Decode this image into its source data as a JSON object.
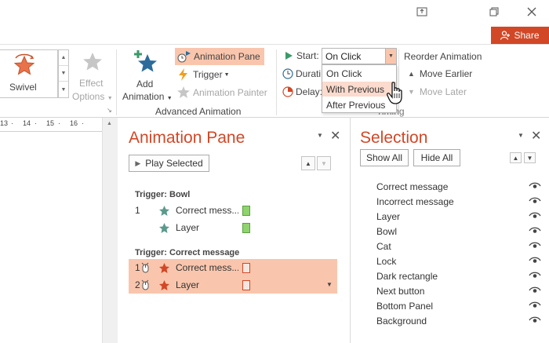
{
  "window": {
    "restore_icon": "restore-window-icon",
    "maximize_icon": "maximize-icon",
    "close_icon": "close-icon"
  },
  "share": {
    "label": "Share",
    "icon": "person-icon",
    "color": "#d24726"
  },
  "ribbon": {
    "swivel_label": "Swivel",
    "effect_options_label_1": "Effect",
    "effect_options_label_2": "Options",
    "add_animation_label_1": "Add",
    "add_animation_label_2": "Animation",
    "animation_pane_label": "Animation Pane",
    "trigger_label": "Trigger",
    "animation_painter_label": "Animation Painter",
    "group_advanced": "Advanced Animation",
    "start_label": "Start:",
    "start_value": "On Click",
    "duration_label": "Durati",
    "delay_label": "Delay:",
    "timing_group": "Timing",
    "reorder_label": "Reorder Animation",
    "move_earlier_label": "Move Earlier",
    "move_later_label": "Move Later",
    "start_options": [
      "On Click",
      "With Previous",
      "After Previous"
    ]
  },
  "ruler": {
    "ticks": [
      "13",
      "14",
      "15",
      "16"
    ]
  },
  "animation_pane": {
    "title": "Animation Pane",
    "play_selected": "Play Selected",
    "groups": [
      {
        "trigger": "Trigger: Bowl",
        "items": [
          {
            "num": "1",
            "name": "Correct mess...",
            "star_color": "#5a9a8c",
            "box_color": "#8ed36c",
            "box_border": "#5aa040"
          },
          {
            "num": "",
            "name": "Layer",
            "star_color": "#5a9a8c",
            "box_color": "#8ed36c",
            "box_border": "#5aa040"
          }
        ]
      },
      {
        "trigger": "Trigger: Correct message",
        "items": [
          {
            "num": "1",
            "name": "Correct mess...",
            "star_color": "#d24726",
            "box_color": "#f6e6e0",
            "box_border": "#d24726"
          },
          {
            "num": "2",
            "name": "Layer",
            "star_color": "#d24726",
            "box_color": "#f6e6e0",
            "box_border": "#d24726"
          }
        ]
      }
    ]
  },
  "selection_pane": {
    "title": "Selection",
    "show_all": "Show All",
    "hide_all": "Hide All",
    "items": [
      "Correct message",
      "Incorrect message",
      "Layer",
      "Bowl",
      "Cat",
      "Lock",
      "Dark rectangle",
      "Next button",
      "Bottom Panel",
      "Background"
    ]
  },
  "colors": {
    "accent": "#d24726",
    "highlight": "#f9c6ad"
  }
}
